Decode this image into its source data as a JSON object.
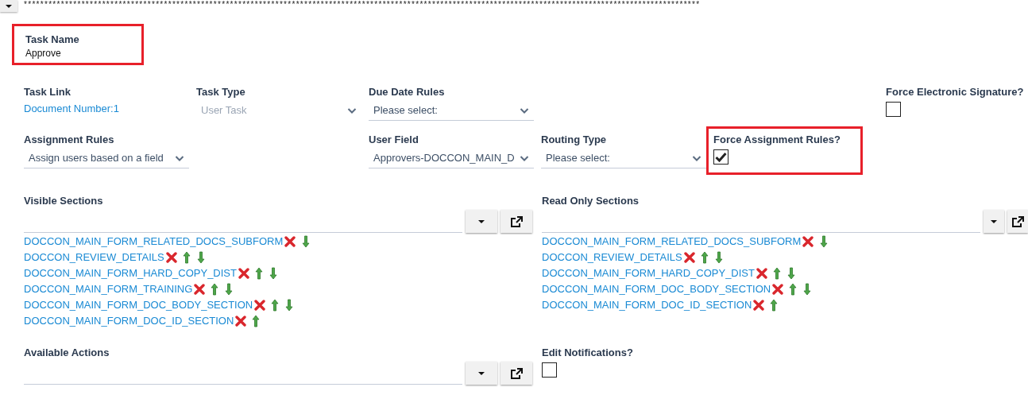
{
  "top_bar": {
    "divider_text": "********************************************************************************************************************************************************************"
  },
  "task_name": {
    "label": "Task Name",
    "value": "Approve",
    "highlighted": true
  },
  "field_rows": [
    {
      "fields": [
        {
          "kind": "link",
          "label": "Task Link",
          "value": "Document Number:1"
        },
        {
          "kind": "select",
          "label": "Task Type",
          "value": "User Task",
          "disabled": true
        },
        {
          "kind": "select",
          "label": "Due Date Rules",
          "placeholder": "Please select:",
          "disabled": false
        },
        {
          "kind": "checkbox",
          "label": "Force Electronic Signature?",
          "checked": false,
          "highlighted": false
        }
      ]
    },
    {
      "fields": [
        {
          "kind": "select",
          "label": "Assignment Rules",
          "value": "Assign users based on a field",
          "disabled": false
        },
        {
          "kind": "select",
          "label": "User Field",
          "value": "Approvers-DOCCON_MAIN_D",
          "disabled": false
        },
        {
          "kind": "select",
          "label": "Routing Type",
          "placeholder": "Please select:",
          "disabled": false
        },
        {
          "kind": "checkbox",
          "label": "Force Assignment Rules?",
          "checked": true,
          "highlighted": true
        }
      ]
    }
  ],
  "section_lists": [
    {
      "label": "Visible Sections",
      "items": [
        {
          "name": "DOCCON_MAIN_FORM_RELATED_DOCS_SUBFORM",
          "up": false,
          "down": true
        },
        {
          "name": "DOCCON_REVIEW_DETAILS",
          "up": true,
          "down": true
        },
        {
          "name": "DOCCON_MAIN_FORM_HARD_COPY_DIST",
          "up": true,
          "down": true
        },
        {
          "name": "DOCCON_MAIN_FORM_TRAINING",
          "up": true,
          "down": true
        },
        {
          "name": "DOCCON_MAIN_FORM_DOC_BODY_SECTION",
          "up": true,
          "down": true
        },
        {
          "name": "DOCCON_MAIN_FORM_DOC_ID_SECTION",
          "up": true,
          "down": false
        }
      ]
    },
    {
      "label": "Read Only Sections",
      "items": [
        {
          "name": "DOCCON_MAIN_FORM_RELATED_DOCS_SUBFORM",
          "up": false,
          "down": true
        },
        {
          "name": "DOCCON_REVIEW_DETAILS",
          "up": true,
          "down": true
        },
        {
          "name": "DOCCON_MAIN_FORM_HARD_COPY_DIST",
          "up": true,
          "down": true
        },
        {
          "name": "DOCCON_MAIN_FORM_DOC_BODY_SECTION",
          "up": true,
          "down": true
        },
        {
          "name": "DOCCON_MAIN_FORM_DOC_ID_SECTION",
          "up": true,
          "down": false
        }
      ]
    }
  ],
  "bottom": [
    {
      "kind": "list",
      "label": "Available Actions"
    },
    {
      "kind": "checkbox",
      "label": "Edit Notifications?",
      "checked": false
    }
  ]
}
